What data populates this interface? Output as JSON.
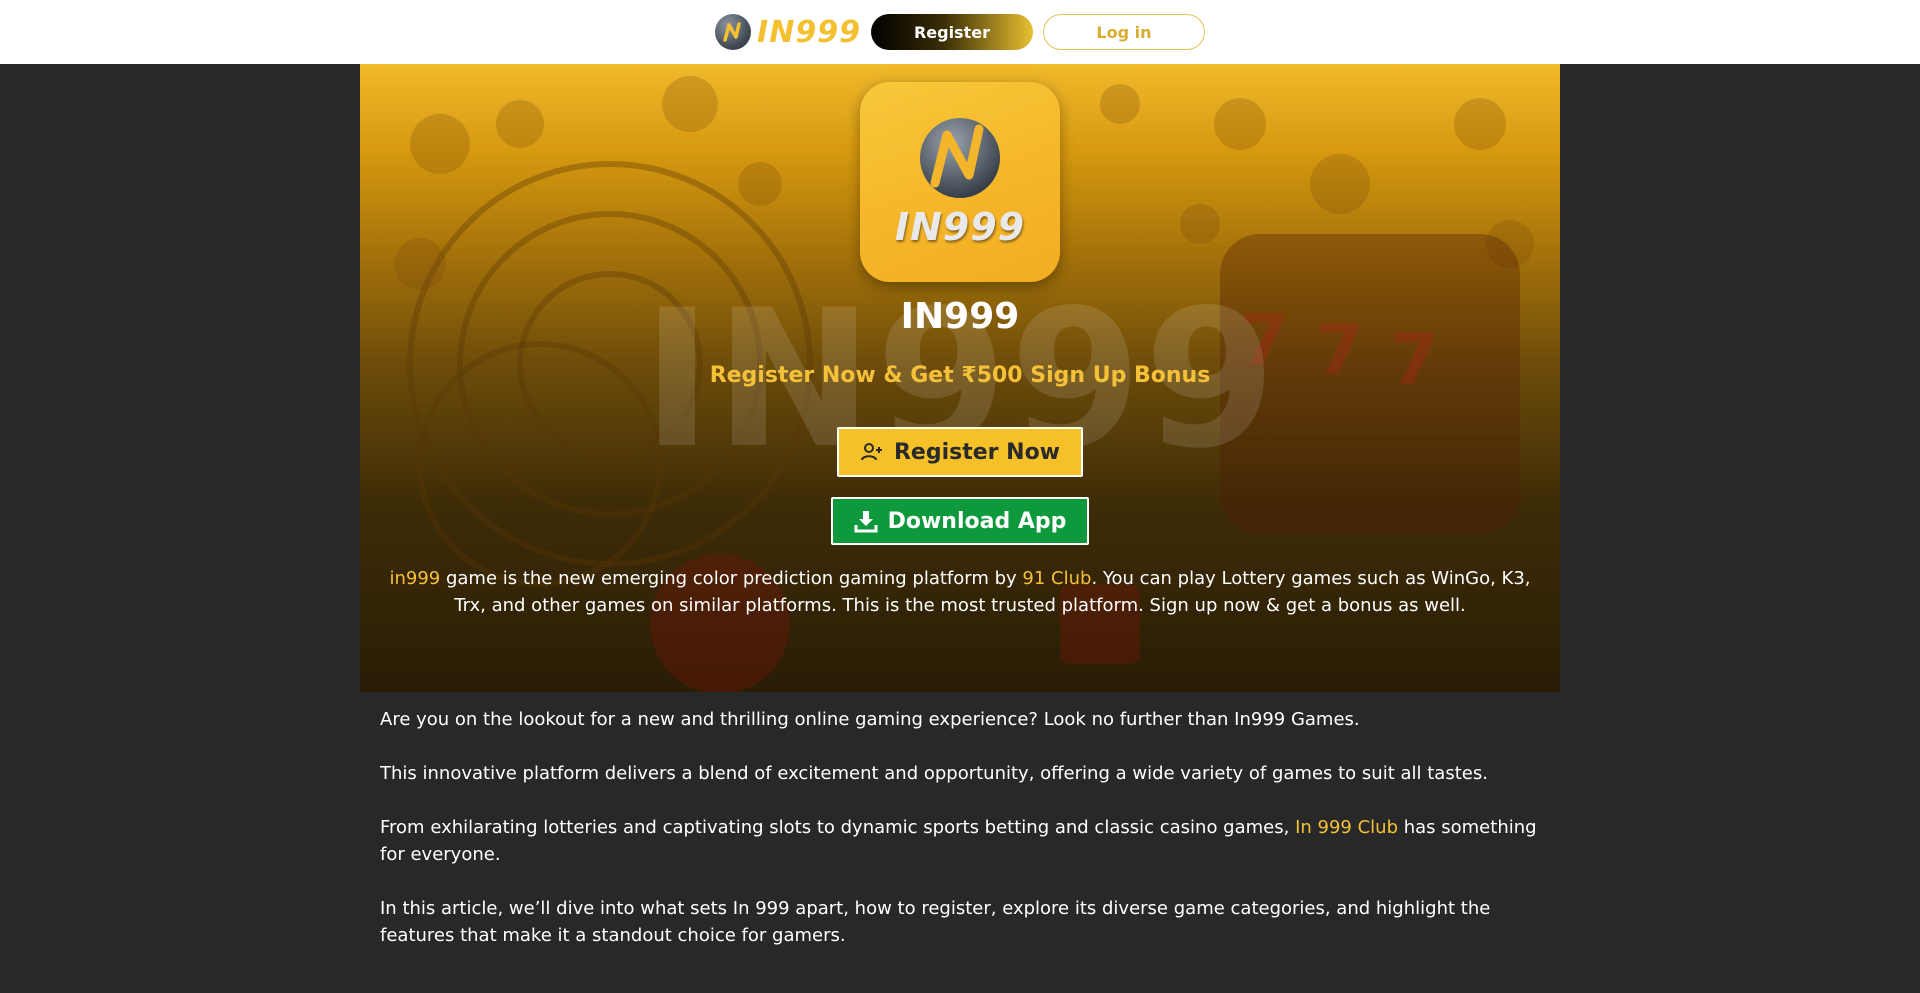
{
  "header": {
    "brand_name": "IN999",
    "register_label": "Register",
    "login_label": "Log in"
  },
  "hero": {
    "watermark": "IN999",
    "app_icon_text": "IN999",
    "title": "IN999",
    "subtitle": "Register Now & Get ₹500 Sign Up Bonus",
    "register_now_label": "Register Now",
    "download_label": "Download App",
    "description": {
      "link1": "in999",
      "text1": " game is the new emerging color prediction gaming platform by ",
      "link2": "91 Club",
      "text2": ". You can play Lottery games such as WinGo, K3, Trx, and other games on similar platforms. This is the most trusted platform. Sign up now & get a bonus as well."
    }
  },
  "article": {
    "p1": "Are you on the lookout for a new and thrilling online gaming experience? Look no further than In999 Games.",
    "p2": "This innovative platform delivers a blend of excitement and opportunity, offering a wide variety of games to suit all tastes.",
    "p3_text1": "From exhilarating lotteries and captivating slots to dynamic sports betting and classic casino games, ",
    "p3_link": "In 999 Club",
    "p3_text2": " has something for everyone.",
    "p4": "In this article, we’ll dive into what sets In 999 apart, how to register, explore its diverse game categories, and highlight the features that make it a standout choice for gamers."
  },
  "colors": {
    "accent": "#f5c139",
    "download_green": "#0e9a3c",
    "page_bg": "#282828"
  },
  "icons": [
    "in999-logo-icon",
    "user-plus-icon",
    "download-icon"
  ]
}
